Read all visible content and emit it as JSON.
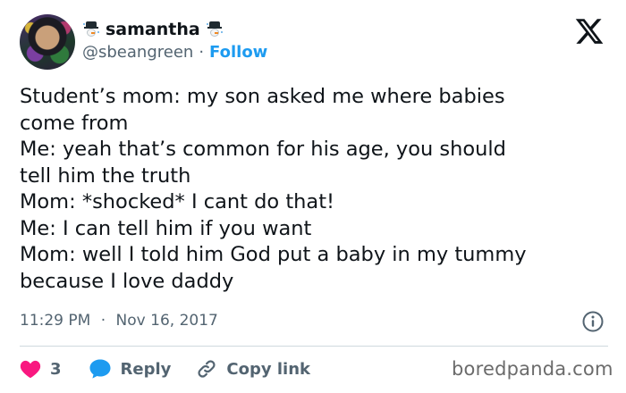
{
  "user": {
    "display_name": "samantha",
    "handle": "@sbeangreen",
    "separator": "·",
    "follow_label": "Follow",
    "name_emoji": "snowman-with-hat-icon"
  },
  "tweet": {
    "lines": [
      "Student’s mom: my son asked me where babies",
      "come from",
      "Me: yeah that’s common for his age, you should",
      "tell him the truth",
      "Mom: *shocked* I cant do that!",
      "Me: I can tell him if you want",
      "Mom: well I told him God put a baby in my tummy",
      "because I love daddy"
    ],
    "time": "11:29 PM",
    "separator": "·",
    "date": "Nov 16, 2017"
  },
  "actions": {
    "likes": "3",
    "reply_label": "Reply",
    "copy_label": "Copy link"
  },
  "watermark": "boredpanda.com",
  "colors": {
    "text": "#0f1419",
    "secondary": "#536471",
    "accent": "#1d9bf0",
    "like": "#f91880",
    "divider": "#cfd9de"
  },
  "icons": {
    "brand": "x-logo-icon",
    "info": "info-icon",
    "like": "heart-icon",
    "reply": "speech-bubble-icon",
    "copy": "link-icon"
  }
}
